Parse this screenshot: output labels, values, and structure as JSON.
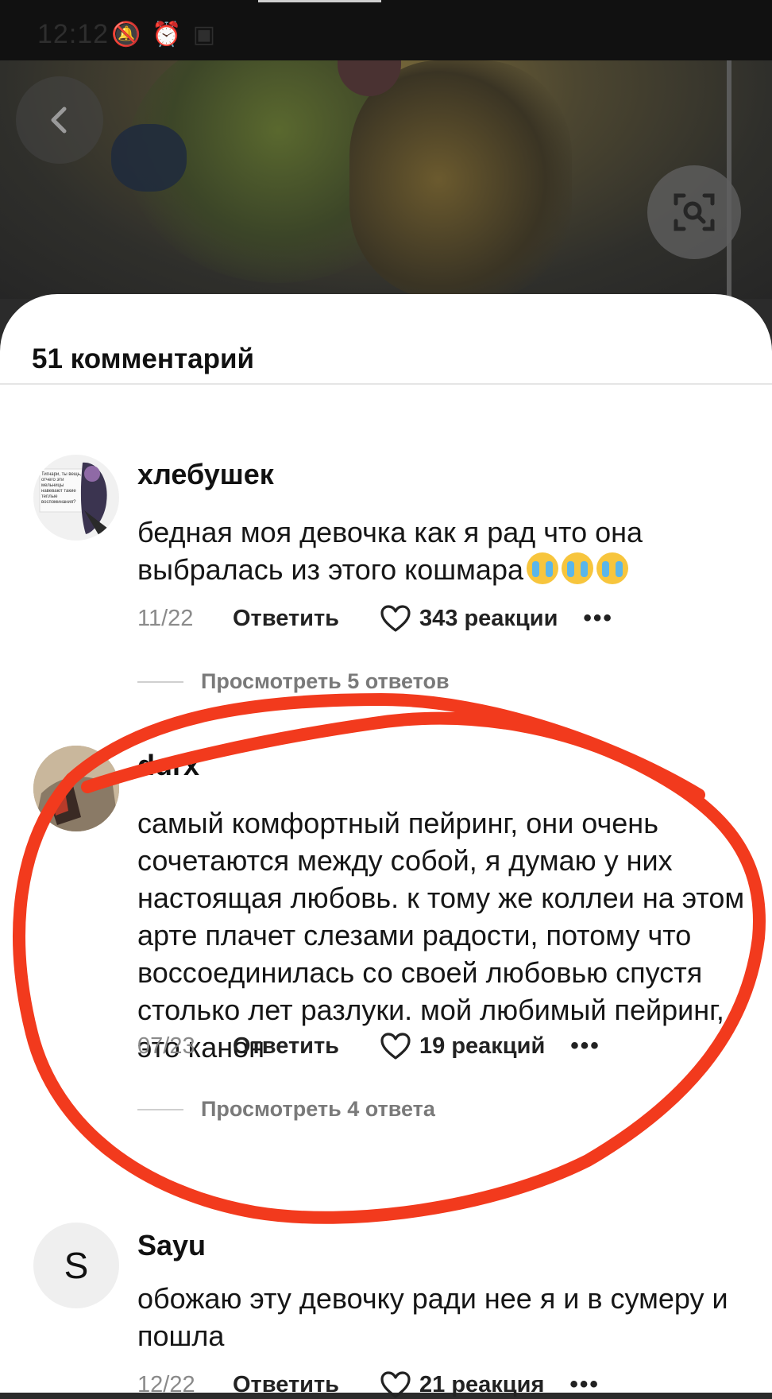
{
  "status_bar": {
    "time": "12:12"
  },
  "sheet": {
    "title": "51 комментарий"
  },
  "comments": [
    {
      "author": "хлебушек",
      "avatar_text": "Тигнари, ты вещь, отчего эти мельницы навевают такие теплые воспоминания?",
      "text": "бедная моя девочка как я рад что она выбралась из этого кошмара",
      "emojis": [
        "crying-face",
        "crying-face",
        "crying-face"
      ],
      "date": "11/22",
      "reply_label": "Ответить",
      "reactions": "343 реакции",
      "replies": "Просмотреть 5 ответов"
    },
    {
      "author": "durx",
      "text": "самый комфортный пейринг, они очень сочетаются между собой, я думаю у них настоящая любовь. к тому же коллеи на этом арте плачет слезами радости, потому что воссоединилась со своей любовью спустя столько лет разлуки. мой любимый пейринг, это канон",
      "date": "07/23",
      "reply_label": "Ответить",
      "reactions": "19 реакций",
      "replies": "Просмотреть 4 ответа"
    },
    {
      "author": "Sayu",
      "avatar_letter": "S",
      "text": "обожаю эту девочку ради нее я и в сумеру и пошла",
      "date": "12/22",
      "reply_label": "Ответить",
      "reactions": "21 реакция"
    }
  ],
  "colors": {
    "annotation": "#f23a1d",
    "sheet": "#ffffff"
  }
}
